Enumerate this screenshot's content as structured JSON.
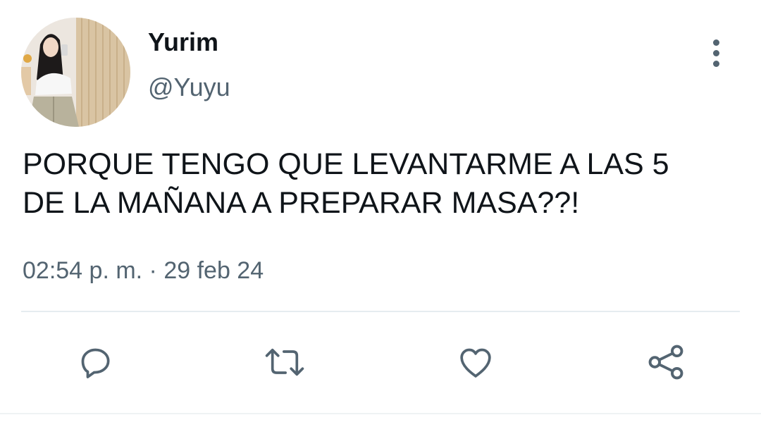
{
  "tweet": {
    "author": {
      "display_name": "Yurim",
      "handle": "@Yuyu",
      "avatar_icon": "profile-photo"
    },
    "text_lines": [
      "PORQUE TENGO QUE LEVANTARME A LAS 5",
      "DE LA MAÑANA A PREPARAR MASA??!"
    ],
    "time": "02:54 p. m.",
    "separator": " · ",
    "date": "29 feb 24"
  },
  "actions": [
    {
      "name": "reply",
      "icon": "comment-icon"
    },
    {
      "name": "retweet",
      "icon": "retweet-icon"
    },
    {
      "name": "like",
      "icon": "heart-icon"
    },
    {
      "name": "share",
      "icon": "share-icon"
    }
  ],
  "colors": {
    "text_primary": "#0f1419",
    "text_secondary": "#536471",
    "divider": "#e6ecf0"
  }
}
